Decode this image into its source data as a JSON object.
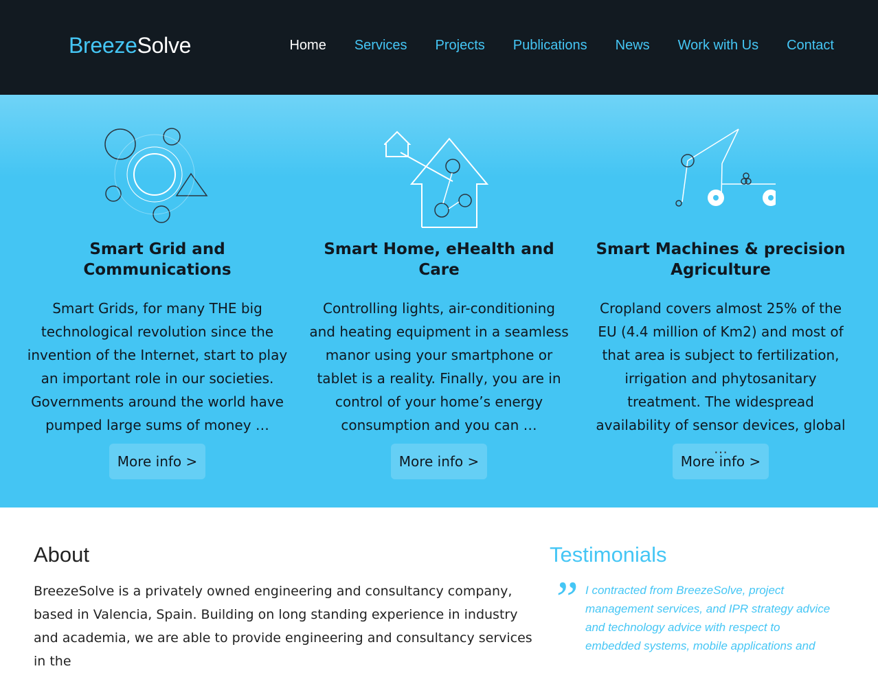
{
  "brand": {
    "part1": "Breeze",
    "part2": "Solve"
  },
  "nav": [
    {
      "label": "Home"
    },
    {
      "label": "Services"
    },
    {
      "label": "Projects"
    },
    {
      "label": "Publications"
    },
    {
      "label": "News"
    },
    {
      "label": "Work with Us"
    },
    {
      "label": "Contact"
    }
  ],
  "features": [
    {
      "icon": "smart-grid-icon",
      "title": "Smart Grid and Communications",
      "text": "Smart Grids, for many THE big technological revolution since the invention of the Internet, start to play an important role in our societies. Governments around the world have pumped large sums of money …",
      "button": "More info >"
    },
    {
      "icon": "smart-home-icon",
      "title": "Smart Home, eHealth and Care",
      "text": "Controlling lights, air-conditioning and heating equipment in a seamless manor using your smartphone or tablet is a reality. Finally, you are in control of your home’s energy consumption and you can …",
      "button": "More info >"
    },
    {
      "icon": "tractor-icon",
      "title": "Smart Machines & precision Agriculture",
      "text": "Cropland covers almost 25% of the EU (4.4 million of Km2) and most of that area is subject to fertilization, irrigation and phytosanitary treatment. The widespread availability of sensor devices, global …",
      "button": "More info >"
    }
  ],
  "about": {
    "heading": "About",
    "text": "BreezeSolve is a privately owned engineering and consultancy company, based in Valencia, Spain. Building on long standing experience in industry and academia, we are able to provide engineering and consultancy services in the"
  },
  "testimonials": {
    "heading": "Testimonials",
    "quote": "I contracted from BreezeSolve, project management services, and IPR strategy advice and technology advice with respect to embedded systems, mobile applications and"
  },
  "colors": {
    "accent": "#45c6f5",
    "header_bg": "#121a21",
    "hero_bg": "#44c5f3"
  }
}
